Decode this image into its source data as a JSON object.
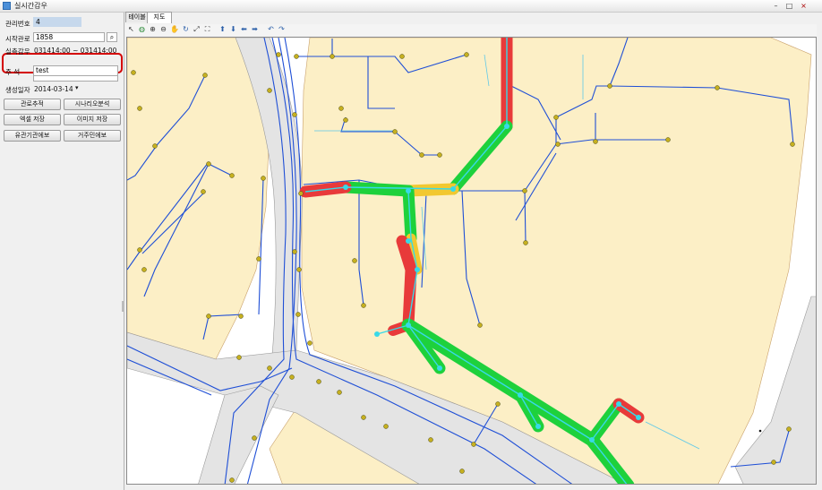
{
  "window": {
    "title": "실시간감우"
  },
  "left_panel": {
    "mgmt_no_label": "관리번호",
    "mgmt_no_value": "4",
    "start_pipe_label": "시작관로",
    "start_pipe_value": "1858",
    "period_label": "실측감우",
    "period_value": "031414:00 ~ 031414:00",
    "note_label": "주    석",
    "note_value": "test",
    "created_label": "생성일자",
    "created_value": "2014-03-14",
    "buttons": [
      "관로추적",
      "시나리오분석",
      "엑셀 저장",
      "이미지 저장",
      "유관기관에보",
      "거주민에보"
    ]
  },
  "tabs": [
    "테이블",
    "지도"
  ],
  "toolbar_icons": [
    "pointer-icon",
    "globe-icon",
    "zoom-in-icon",
    "zoom-out-icon",
    "pan-hand-icon",
    "refresh-icon",
    "full-extent-icon",
    "zoom-extent-icon",
    "arrow-up-icon",
    "arrow-down-icon",
    "arrow-left-icon",
    "arrow-right-icon",
    "undo-icon",
    "redo-icon"
  ],
  "toolbar_glyphs": [
    "↖",
    "◍",
    "⊕",
    "⊖",
    "✋",
    "↻",
    "⤢",
    "⛶",
    "⬆",
    "⬇",
    "⬅",
    "➡",
    "↶",
    "↷"
  ],
  "colors": {
    "land": "#fcefc6",
    "road": "#e4e4e4",
    "pipe": "#1f4fd6",
    "trace_green": "#1ed13c",
    "trace_red": "#e83a3a",
    "trace_yellow": "#f2c830",
    "trace_core": "#38d9e8",
    "node": "#c6b020",
    "highlight": "#d40000"
  }
}
